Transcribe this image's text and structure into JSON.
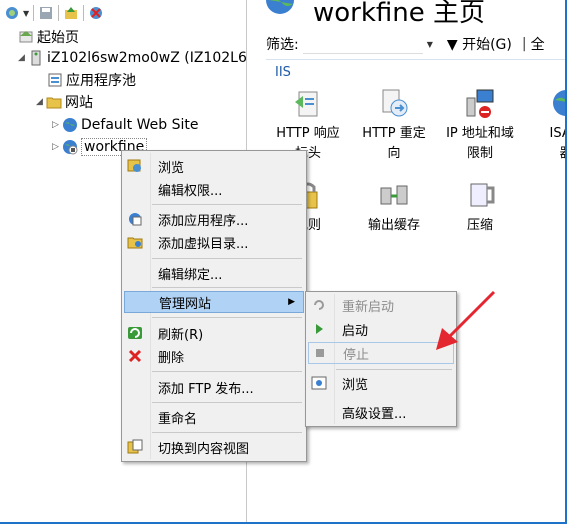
{
  "toolbar": {
    "icons": [
      "connect-icon",
      "save-icon",
      "up-icon",
      "disconnect-icon"
    ]
  },
  "tree": {
    "start_page": "起始页",
    "server": "iZ102l6sw2mo0wZ (IZ102L6",
    "app_pools": "应用程序池",
    "sites": "网站",
    "default_site": "Default Web Site",
    "workfine": "workfine"
  },
  "right": {
    "title": "workfine 主页",
    "filter_label": "筛选:",
    "start_label": "▼ 开始(G)",
    "show_all": "全",
    "group": "IIS",
    "features": [
      {
        "line1": "HTTP 响应",
        "line2": "标头"
      },
      {
        "line1": "HTTP 重定",
        "line2": "向"
      },
      {
        "line1": "IP 地址和域",
        "line2": "限制"
      },
      {
        "line1": "ISAPI",
        "line2": "器"
      },
      {
        "line1": "规则",
        "line2": ""
      },
      {
        "line1": "输出缓存",
        "line2": ""
      },
      {
        "line1": "压缩",
        "line2": ""
      }
    ]
  },
  "context_menu": {
    "browse": "浏览",
    "edit_permissions": "编辑权限...",
    "add_application": "添加应用程序...",
    "add_virtual_dir": "添加虚拟目录...",
    "edit_bindings": "编辑绑定...",
    "manage_site": "管理网站",
    "refresh": "刷新(R)",
    "delete": "删除",
    "add_ftp": "添加 FTP 发布...",
    "rename": "重命名",
    "switch_content_view": "切换到内容视图"
  },
  "submenu": {
    "restart": "重新启动",
    "start": "启动",
    "stop": "停止",
    "browse": "浏览",
    "advanced": "高级设置..."
  },
  "colors": {
    "accent": "#1e73c8",
    "highlight": "#b0d2f5",
    "arrow_red": "#e3262f",
    "section_blue": "#1e5aa8"
  }
}
